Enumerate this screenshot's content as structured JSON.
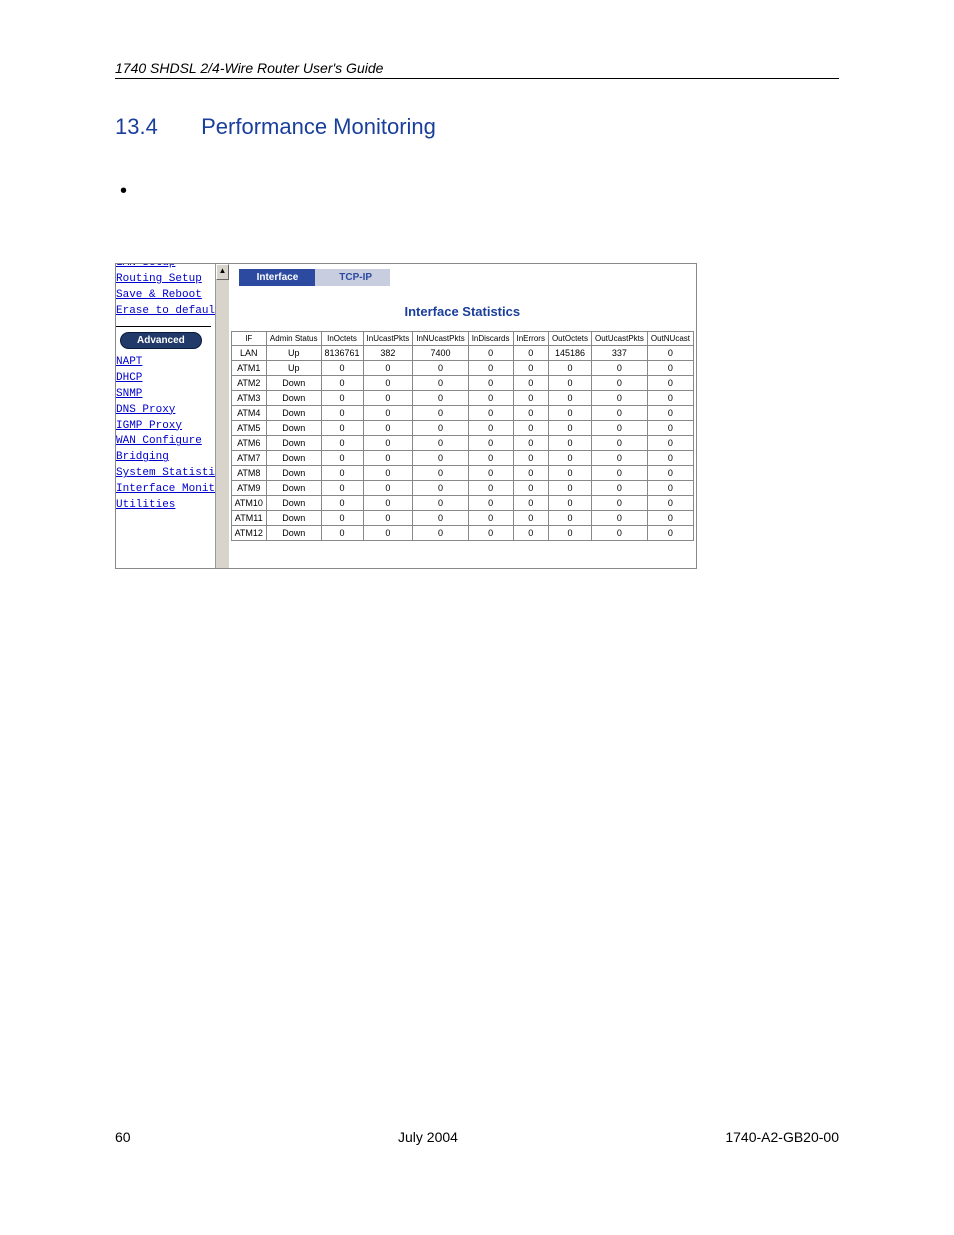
{
  "header": {
    "running": "1740 SHDSL 2/4-Wire Router User's Guide"
  },
  "section": {
    "number": "13.4",
    "title": "Performance Monitoring"
  },
  "sidebar": {
    "cut_top": "LAN Setup",
    "items_top": [
      "Routing Setup",
      "Save & Reboot",
      "Erase to default"
    ],
    "adv_label": "Advanced",
    "items_bottom": [
      "NAPT",
      "DHCP",
      "SNMP",
      "DNS Proxy",
      "IGMP Proxy",
      "WAN Configure",
      "Bridging",
      "System Statistics",
      "Interface Monitor"
    ],
    "cut_bottom": "Utilities"
  },
  "tabs": {
    "active": "Interface",
    "inactive": "TCP-IP"
  },
  "panel_title": "Interface Statistics",
  "columns": [
    "IF",
    "Admin Status",
    "InOctets",
    "InUcastPkts",
    "InNUcastPkts",
    "InDiscards",
    "InErrors",
    "OutOctets",
    "OutUcastPkts",
    "OutNUcast"
  ],
  "rows": [
    {
      "if": "LAN",
      "st": "Up",
      "c": [
        "8136761",
        "382",
        "7400",
        "0",
        "0",
        "145186",
        "337",
        "0"
      ]
    },
    {
      "if": "ATM1",
      "st": "Up",
      "c": [
        "0",
        "0",
        "0",
        "0",
        "0",
        "0",
        "0",
        "0"
      ]
    },
    {
      "if": "ATM2",
      "st": "Down",
      "c": [
        "0",
        "0",
        "0",
        "0",
        "0",
        "0",
        "0",
        "0"
      ]
    },
    {
      "if": "ATM3",
      "st": "Down",
      "c": [
        "0",
        "0",
        "0",
        "0",
        "0",
        "0",
        "0",
        "0"
      ]
    },
    {
      "if": "ATM4",
      "st": "Down",
      "c": [
        "0",
        "0",
        "0",
        "0",
        "0",
        "0",
        "0",
        "0"
      ]
    },
    {
      "if": "ATM5",
      "st": "Down",
      "c": [
        "0",
        "0",
        "0",
        "0",
        "0",
        "0",
        "0",
        "0"
      ]
    },
    {
      "if": "ATM6",
      "st": "Down",
      "c": [
        "0",
        "0",
        "0",
        "0",
        "0",
        "0",
        "0",
        "0"
      ]
    },
    {
      "if": "ATM7",
      "st": "Down",
      "c": [
        "0",
        "0",
        "0",
        "0",
        "0",
        "0",
        "0",
        "0"
      ]
    },
    {
      "if": "ATM8",
      "st": "Down",
      "c": [
        "0",
        "0",
        "0",
        "0",
        "0",
        "0",
        "0",
        "0"
      ]
    },
    {
      "if": "ATM9",
      "st": "Down",
      "c": [
        "0",
        "0",
        "0",
        "0",
        "0",
        "0",
        "0",
        "0"
      ]
    },
    {
      "if": "ATM10",
      "st": "Down",
      "c": [
        "0",
        "0",
        "0",
        "0",
        "0",
        "0",
        "0",
        "0"
      ]
    },
    {
      "if": "ATM11",
      "st": "Down",
      "c": [
        "0",
        "0",
        "0",
        "0",
        "0",
        "0",
        "0",
        "0"
      ]
    },
    {
      "if": "ATM12",
      "st": "Down",
      "c": [
        "0",
        "0",
        "0",
        "0",
        "0",
        "0",
        "0",
        "0"
      ]
    }
  ],
  "footer": {
    "page": "60",
    "date": "July 2004",
    "docnum": "1740-A2-GB20-00"
  }
}
